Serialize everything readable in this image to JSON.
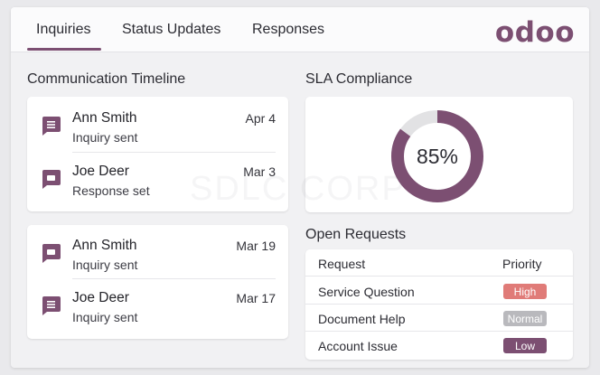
{
  "tabs": [
    {
      "label": "Inquiries",
      "active": true
    },
    {
      "label": "Status Updates",
      "active": false
    },
    {
      "label": "Responses",
      "active": false
    }
  ],
  "brand": {
    "logo_text": "odoo",
    "color": "#7c4f72"
  },
  "timeline": {
    "title": "Communication Timeline",
    "groups": [
      [
        {
          "name": "Ann Smith",
          "status": "Inquiry sent",
          "date": "Apr 4",
          "icon": "document-icon"
        },
        {
          "name": "Joe Deer",
          "status": "Response set",
          "date": "Mar 3",
          "icon": "chat-icon"
        }
      ],
      [
        {
          "name": "Ann Smith",
          "status": "Inquiry sent",
          "date": "Mar 19",
          "icon": "chat-icon"
        },
        {
          "name": "Joe Deer",
          "status": "Inquiry sent",
          "date": "Mar 17",
          "icon": "document-icon"
        }
      ]
    ]
  },
  "sla": {
    "title": "SLA Compliance",
    "value_label": "85%",
    "fraction": 0.85,
    "fill_color": "#7c4f72",
    "track_color": "#e2e2e4"
  },
  "requests": {
    "title": "Open Requests",
    "columns": [
      "Request",
      "Priority"
    ],
    "rows": [
      {
        "request": "Service Question",
        "priority": "High",
        "color": "#e07b78"
      },
      {
        "request": "Document Help",
        "priority": "Normal",
        "color": "#b9b9bd"
      },
      {
        "request": "Account Issue",
        "priority": "Low",
        "color": "#7c4f72"
      }
    ]
  },
  "watermark": "SDLC CORP"
}
